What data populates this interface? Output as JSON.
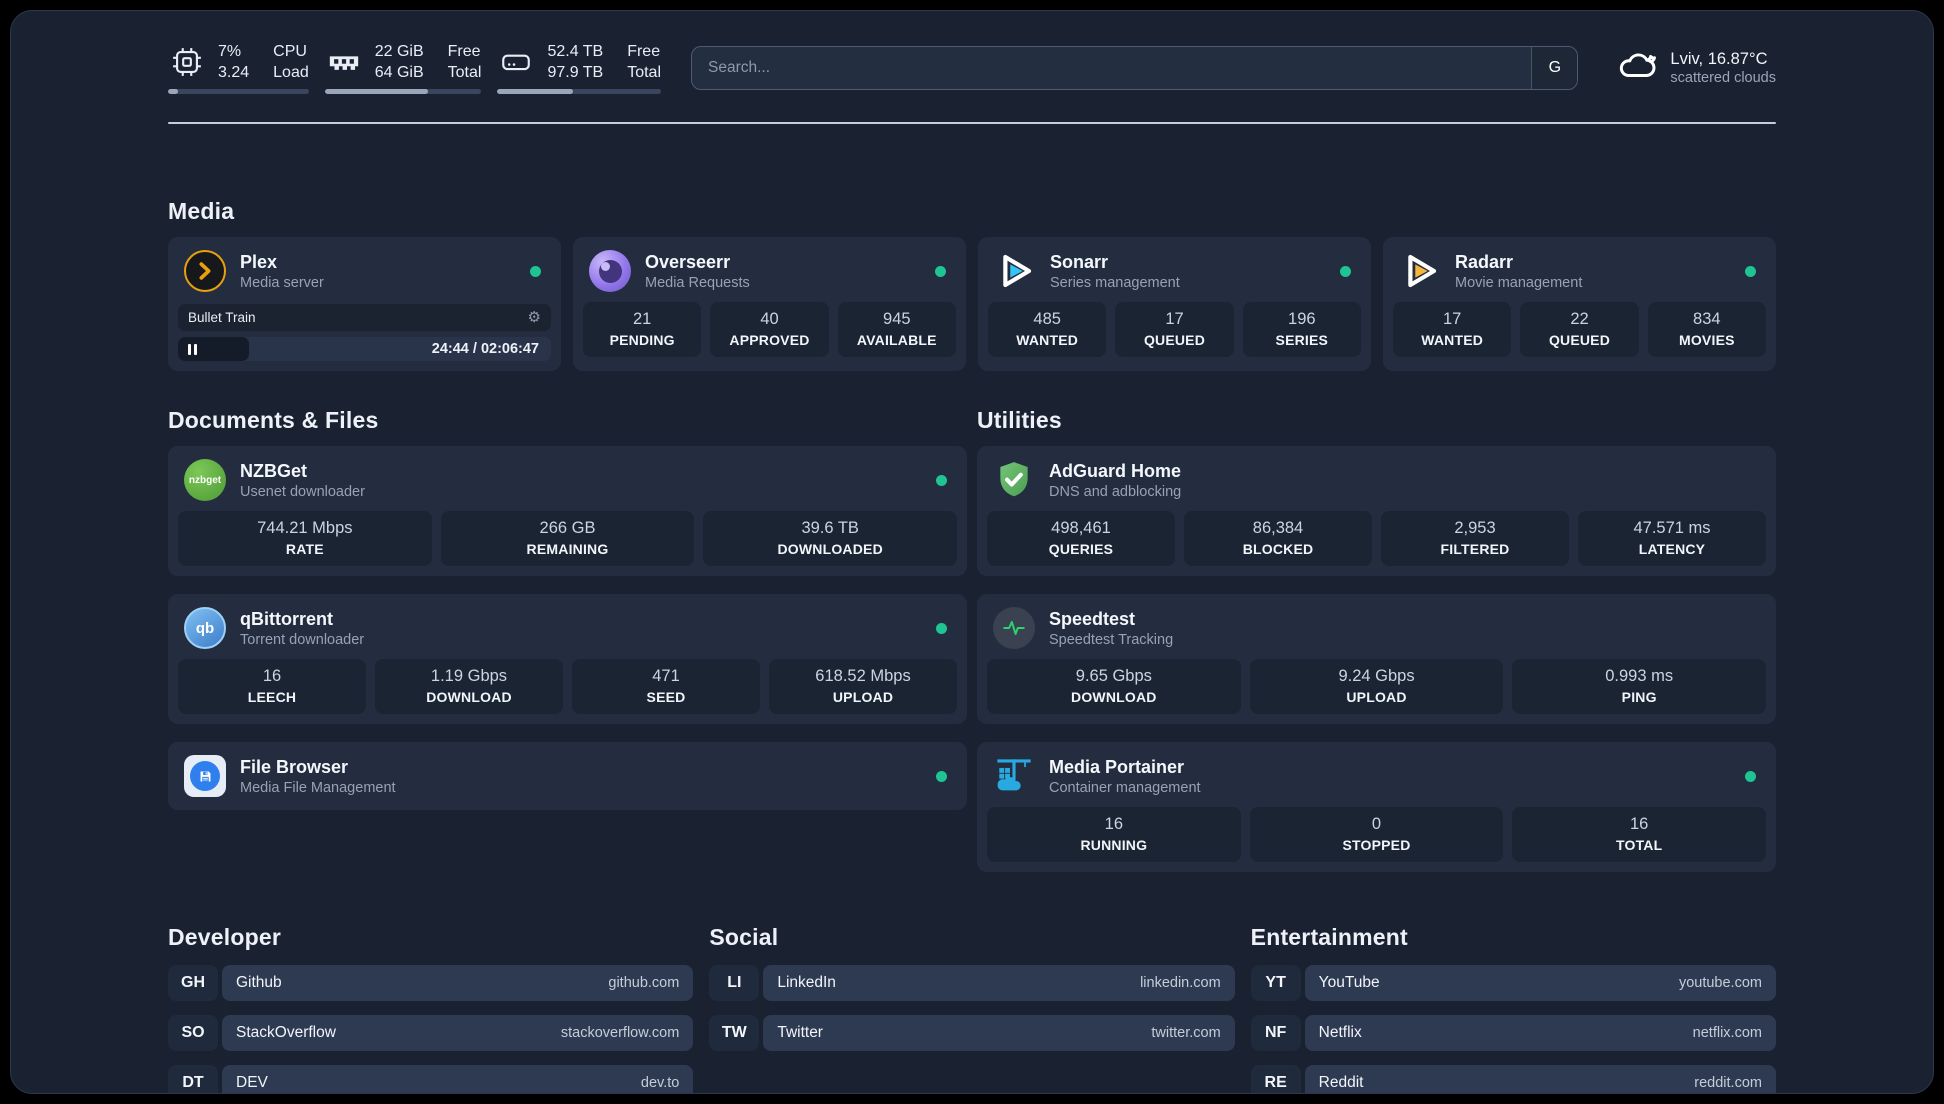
{
  "glyphs": {
    "gear": "⚙"
  },
  "colors": {
    "accent_green": "#1ec492",
    "plex_amber": "#e8a00c",
    "sonarr_blue": "#35c5f4",
    "radarr_amber": "#f5b53f"
  },
  "header": {
    "metrics": [
      {
        "icon": "cpu-icon",
        "col1": [
          "7%",
          "3.24"
        ],
        "col2": [
          "CPU",
          "Load"
        ],
        "progress": 7
      },
      {
        "icon": "ram-icon",
        "col1": [
          "22 GiB",
          "64 GiB"
        ],
        "col2": [
          "Free",
          "Total"
        ],
        "progress": 66
      },
      {
        "icon": "disk-icon",
        "col1": [
          "52.4 TB",
          "97.9 TB"
        ],
        "col2": [
          "Free",
          "Total"
        ],
        "progress": 46
      }
    ],
    "search": {
      "placeholder": "Search...",
      "engine": "G"
    },
    "weather": {
      "summary": "Lviv, 16.87°C",
      "condition": "scattered clouds"
    }
  },
  "sections": {
    "media": {
      "title": "Media",
      "apps": [
        {
          "name": "Plex",
          "subtitle": "Media server",
          "icon": "plex-icon",
          "online": true,
          "now_playing": {
            "title": "Bullet Train",
            "time": "24:44 / 02:06:47",
            "progress": 19
          }
        },
        {
          "name": "Overseerr",
          "subtitle": "Media Requests",
          "icon": "overseerr-icon",
          "online": true,
          "stats": [
            {
              "value": "21",
              "label": "PENDING"
            },
            {
              "value": "40",
              "label": "APPROVED"
            },
            {
              "value": "945",
              "label": "AVAILABLE"
            }
          ]
        },
        {
          "name": "Sonarr",
          "subtitle": "Series management",
          "icon": "sonarr-icon",
          "online": true,
          "stats": [
            {
              "value": "485",
              "label": "WANTED"
            },
            {
              "value": "17",
              "label": "QUEUED"
            },
            {
              "value": "196",
              "label": "SERIES"
            }
          ]
        },
        {
          "name": "Radarr",
          "subtitle": "Movie management",
          "icon": "radarr-icon",
          "online": true,
          "stats": [
            {
              "value": "17",
              "label": "WANTED"
            },
            {
              "value": "22",
              "label": "QUEUED"
            },
            {
              "value": "834",
              "label": "MOVIES"
            }
          ]
        }
      ]
    },
    "documents": {
      "title": "Documents & Files",
      "apps": [
        {
          "name": "NZBGet",
          "subtitle": "Usenet downloader",
          "icon": "nzbget-icon",
          "icon_text": "nzbget",
          "online": true,
          "stats": [
            {
              "value": "744.21 Mbps",
              "label": "RATE"
            },
            {
              "value": "266 GB",
              "label": "REMAINING"
            },
            {
              "value": "39.6 TB",
              "label": "DOWNLOADED"
            }
          ]
        },
        {
          "name": "qBittorrent",
          "subtitle": "Torrent downloader",
          "icon": "qbittorrent-icon",
          "icon_text": "qb",
          "online": true,
          "stats": [
            {
              "value": "16",
              "label": "LEECH"
            },
            {
              "value": "1.19 Gbps",
              "label": "DOWNLOAD"
            },
            {
              "value": "471",
              "label": "SEED"
            },
            {
              "value": "618.52 Mbps",
              "label": "UPLOAD"
            }
          ]
        },
        {
          "name": "File Browser",
          "subtitle": "Media File Management",
          "icon": "filebrowser-icon",
          "online": true,
          "stats": []
        }
      ]
    },
    "utilities": {
      "title": "Utilities",
      "apps": [
        {
          "name": "AdGuard Home",
          "subtitle": "DNS and adblocking",
          "icon": "adguard-icon",
          "online": false,
          "stats": [
            {
              "value": "498,461",
              "label": "QUERIES"
            },
            {
              "value": "86,384",
              "label": "BLOCKED"
            },
            {
              "value": "2,953",
              "label": "FILTERED"
            },
            {
              "value": "47.571 ms",
              "label": "LATENCY"
            }
          ]
        },
        {
          "name": "Speedtest",
          "subtitle": "Speedtest Tracking",
          "icon": "speedtest-icon",
          "online": false,
          "stats": [
            {
              "value": "9.65 Gbps",
              "label": "DOWNLOAD"
            },
            {
              "value": "9.24 Gbps",
              "label": "UPLOAD"
            },
            {
              "value": "0.993 ms",
              "label": "PING"
            }
          ]
        },
        {
          "name": "Media Portainer",
          "subtitle": "Container management",
          "icon": "portainer-icon",
          "online": true,
          "stats": [
            {
              "value": "16",
              "label": "RUNNING"
            },
            {
              "value": "0",
              "label": "STOPPED"
            },
            {
              "value": "16",
              "label": "TOTAL"
            }
          ]
        }
      ]
    },
    "bookmarks": [
      {
        "title": "Developer",
        "links": [
          {
            "abbr": "GH",
            "name": "Github",
            "url": "github.com"
          },
          {
            "abbr": "SO",
            "name": "StackOverflow",
            "url": "stackoverflow.com"
          },
          {
            "abbr": "DT",
            "name": "DEV",
            "url": "dev.to"
          }
        ]
      },
      {
        "title": "Social",
        "links": [
          {
            "abbr": "LI",
            "name": "LinkedIn",
            "url": "linkedin.com"
          },
          {
            "abbr": "TW",
            "name": "Twitter",
            "url": "twitter.com"
          }
        ]
      },
      {
        "title": "Entertainment",
        "links": [
          {
            "abbr": "YT",
            "name": "YouTube",
            "url": "youtube.com"
          },
          {
            "abbr": "NF",
            "name": "Netflix",
            "url": "netflix.com"
          },
          {
            "abbr": "RE",
            "name": "Reddit",
            "url": "reddit.com"
          }
        ]
      }
    ]
  }
}
